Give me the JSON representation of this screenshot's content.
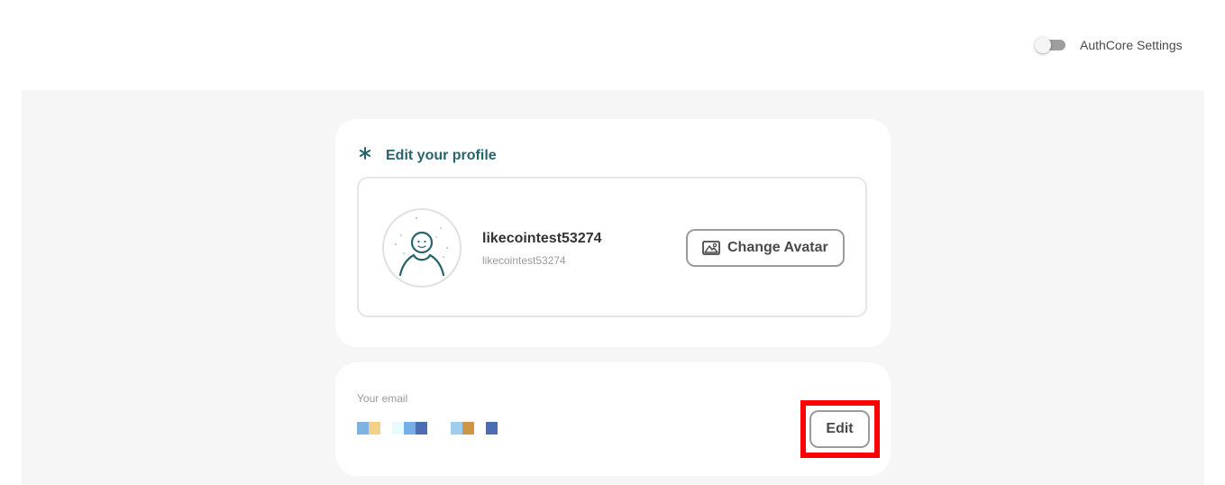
{
  "header": {
    "toggle_label": "AuthCore Settings",
    "toggle_on": false
  },
  "profile": {
    "heading": "Edit your profile",
    "display_name": "likecointest53274",
    "user_id": "likecointest53274",
    "change_avatar_label": "Change Avatar"
  },
  "email": {
    "label": "Your email",
    "edit_label": "Edit"
  },
  "colors": {
    "accent": "#28646e",
    "highlight": "#ff0000",
    "background": "#f6f6f6"
  },
  "icons": {
    "heading": "asterisk-icon",
    "avatar": "person-avatar-icon",
    "change_avatar": "image-icon"
  }
}
